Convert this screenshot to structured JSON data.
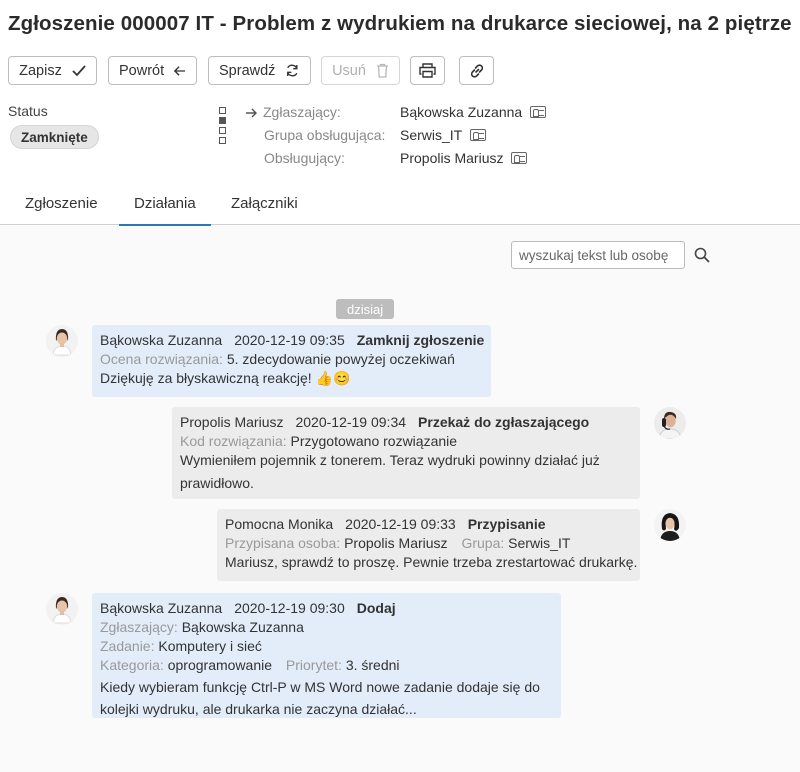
{
  "ticket": {
    "title": "Zgłoszenie 000007 IT - Problem z wydrukiem na drukarce sieciowej, na 2 piętrze"
  },
  "toolbar": {
    "save_label": "Zapisz",
    "back_label": "Powrót",
    "check_label": "Sprawdź",
    "delete_label": "Usuń"
  },
  "status": {
    "label": "Status",
    "value": "Zamknięte"
  },
  "people": {
    "requester_label": "Zgłaszający:",
    "requester": "Bąkowska Zuzanna",
    "group_label": "Grupa obsługująca:",
    "group": "Serwis_IT",
    "handler_label": "Obsługujący:",
    "handler": "Propolis Mariusz"
  },
  "tabs": [
    {
      "label": "Zgłoszenie",
      "active": false
    },
    {
      "label": "Działania",
      "active": true
    },
    {
      "label": "Załączniki",
      "active": false
    }
  ],
  "search": {
    "placeholder": "wyszukaj tekst lub osobę"
  },
  "timeline": {
    "day_label": "dzisiaj",
    "messages": [
      {
        "author": "Bąkowska Zuzanna",
        "time": "2020-12-19 09:35",
        "action": "Zamknij zgłoszenie",
        "f1_label": "Ocena rozwiązania:",
        "f1_value": "5. zdecydowanie powyżej oczekiwań",
        "text1": "Dziękuję za błyskawiczną reakcję! 👍😊"
      },
      {
        "author": "Propolis Mariusz",
        "time": "2020-12-19 09:34",
        "action": "Przekaż do zgłaszającego",
        "f1_label": "Kod rozwiązania:",
        "f1_value": "Przygotowano rozwiązanie",
        "text1": "Wymieniłem pojemnik z tonerem. Teraz wydruki powinny działać już",
        "text2": "prawidłowo."
      },
      {
        "author": "Pomocna Monika",
        "time": "2020-12-19 09:33",
        "action": "Przypisanie",
        "f1_label": "Przypisana osoba:",
        "f1_value": "Propolis Mariusz",
        "f2_label": "Grupa:",
        "f2_value": "Serwis_IT",
        "text1": "Mariusz, sprawdź to proszę. Pewnie trzeba zrestartować drukarkę."
      },
      {
        "author": "Bąkowska Zuzanna",
        "time": "2020-12-19 09:30",
        "action": "Dodaj",
        "f1_label": "Zgłaszający:",
        "f1_value": "Bąkowska Zuzanna",
        "f2_label": "Zadanie:",
        "f2_value": "Komputery i sieć",
        "f3_label": "Kategoria:",
        "f3_value": "oprogramowanie",
        "f4_label": "Priorytet:",
        "f4_value": "3. średni",
        "text1": "Kiedy wybieram funkcję Ctrl-P w MS Word nowe zadanie dodaje się do",
        "text2": "kolejki wydruku, ale drukarka nie zaczyna działać..."
      }
    ]
  },
  "colors": {
    "accent": "#2a7ab0",
    "requester_bubble": "#e3edfa",
    "staff_bubble": "#ececec",
    "status_badge": "#e6e6e6"
  }
}
